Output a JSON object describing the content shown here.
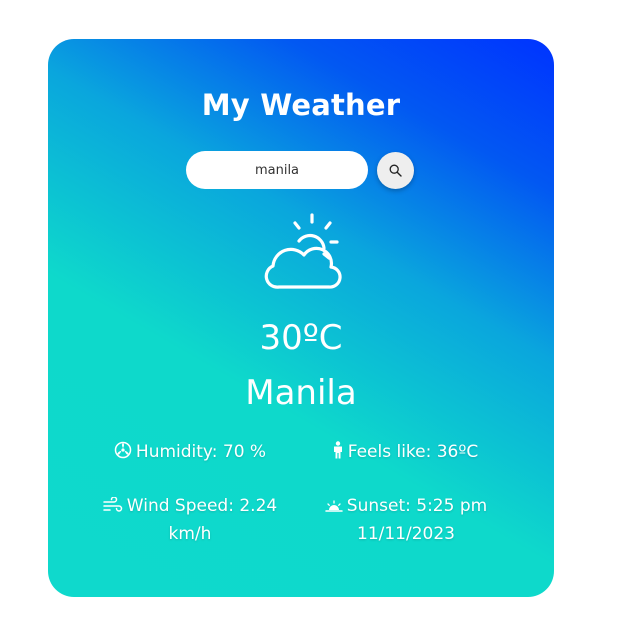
{
  "app": {
    "title": "My Weather"
  },
  "search": {
    "value": "manila",
    "button_icon": "search-icon"
  },
  "current": {
    "icon": "partly-cloudy-icon",
    "temperature": "30ºC",
    "city": "Manila"
  },
  "details": {
    "humidity": {
      "icon": "humidity-icon",
      "text": "Humidity: 70 %"
    },
    "feels_like": {
      "icon": "person-icon",
      "text": "Feels like: 36ºC"
    },
    "wind": {
      "icon": "wind-icon",
      "text_line1": "Wind Speed: 2.24",
      "text_line2": "km/h"
    },
    "sunset": {
      "icon": "sunset-icon",
      "text_line1": "Sunset: 5:25 pm",
      "text_line2": "11/11/2023"
    }
  },
  "colors": {
    "gradient_start": "#0fd9cc",
    "gradient_end": "#0033ff",
    "text": "#ffffff"
  }
}
